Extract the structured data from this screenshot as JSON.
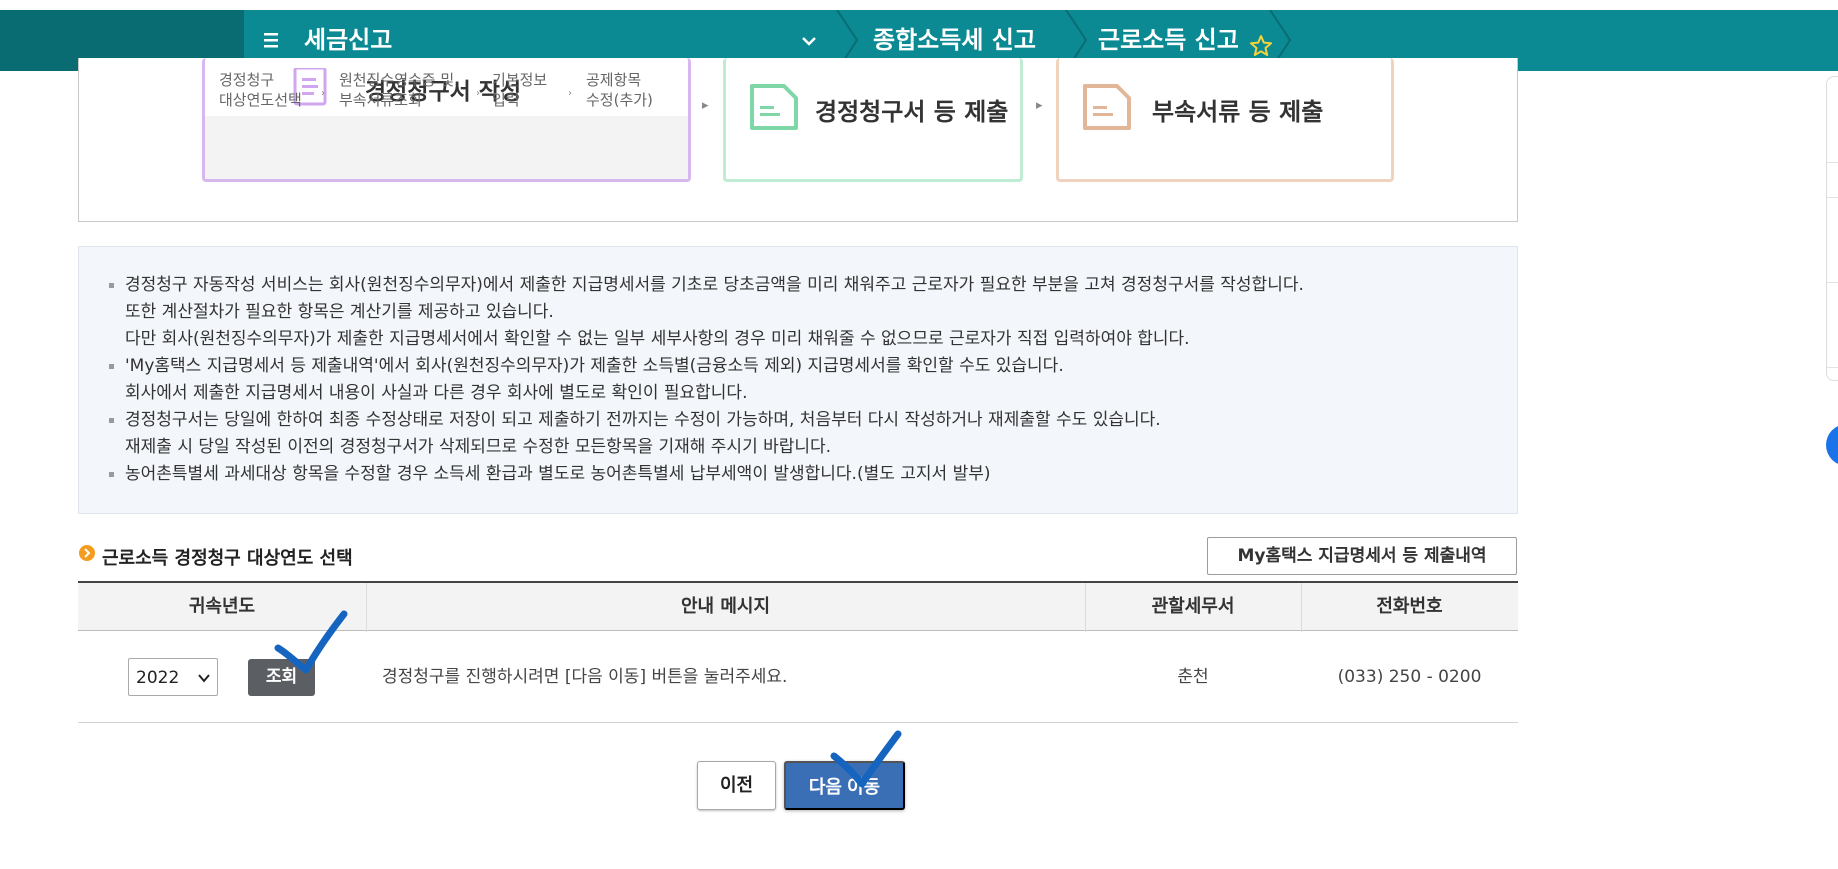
{
  "header": {
    "menu_title": "세금신고",
    "crumbs": [
      "종합소득세 신고",
      "근로소득 신고"
    ]
  },
  "process": {
    "step1_title": "경정청구서 작성",
    "step1_substeps": [
      "경정청구\n대상연도선택",
      "원천징수영수증 및\n부속서류조회",
      "기본정보\n입력",
      "공제항목\n수정(추가)"
    ],
    "step2_title": "경정청구서 등 제출",
    "step3_title": "부속서류 등 제출"
  },
  "notice": {
    "lines": [
      "경정청구 자동작성 서비스는 회사(원천징수의무자)에서 제출한 지급명세서를 기초로 당초금액을 미리 채워주고 근로자가 필요한 부분을 고쳐 경정청구서를 작성합니다.",
      "또한 계산절차가 필요한 항목은 계산기를 제공하고 있습니다.",
      "다만 회사(원천징수의무자)가 제출한 지급명세서에서 확인할 수 없는 일부 세부사항의 경우 미리 채워줄 수 없으므로 근로자가 직접 입력하여야 합니다.",
      "'My홈택스 지급명세서 등 제출내역'에서 회사(원천징수의무자)가 제출한 소득별(금융소득 제외) 지급명세서를 확인할 수도 있습니다.",
      "회사에서 제출한 지급명세서 내용이 사실과 다른 경우 회사에 별도로 확인이 필요합니다.",
      "경정청구서는 당일에 한하여 최종 수정상태로 저장이 되고 제출하기 전까지는 수정이 가능하며, 처음부터 다시 작성하거나 재제출할 수도 있습니다.",
      "재제출 시 당일 작성된 이전의 경정청구서가 삭제되므로 수정한 모든항목을 기재해 주시기 바랍니다.",
      "농어촌특별세 과세대상 항목을 수정할 경우 소득세 환급과 별도로 농어촌특별세 납부세액이 발생합니다.(별도 고지서 발부)"
    ]
  },
  "section": {
    "title": "근로소득 경정청구 대상연도 선택",
    "history_button": "My홈택스 지급명세서 등 제출내역"
  },
  "table": {
    "headers": [
      "귀속년도",
      "안내 메시지",
      "관할세무서",
      "전화번호"
    ],
    "row": {
      "year": "2022",
      "lookup_label": "조회",
      "message": "경정청구를 진행하시려면 [다음 이동] 버튼을 눌러주세요.",
      "office": "춘천",
      "phone": "(033) 250 - 0200"
    }
  },
  "buttons": {
    "prev": "이전",
    "next": "다음 이동"
  },
  "colors": {
    "header_bar": "#0b8a93",
    "header_dark": "#0a6c73",
    "step1_border": "#d6b8ef",
    "step2_border": "#bfecd3",
    "step3_border": "#efd3bf",
    "next_button": "#3a6fb5",
    "lookup_button": "#5b5f64",
    "annotation_check": "#1565c0"
  }
}
